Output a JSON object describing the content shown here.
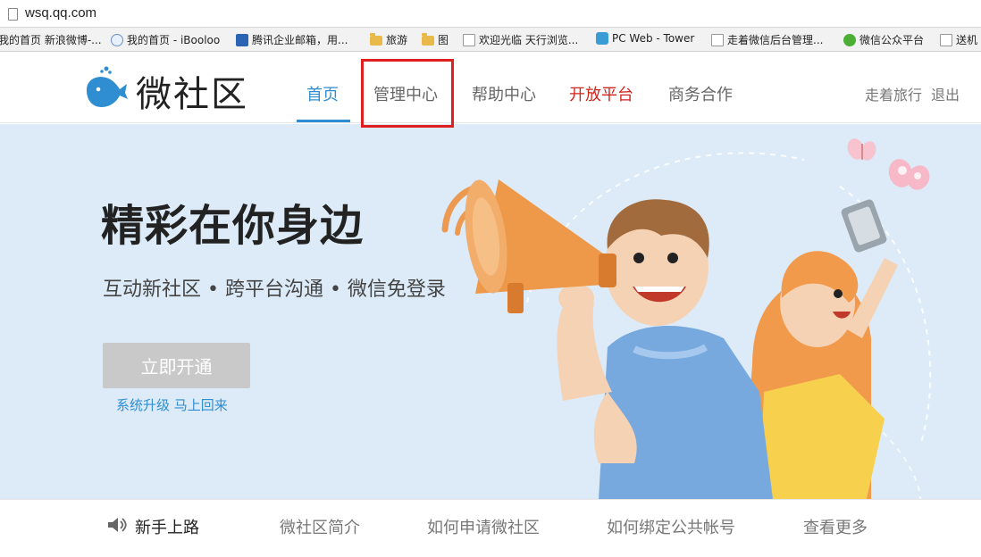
{
  "browser": {
    "url": "wsq.qq.com",
    "bookmarks": [
      {
        "label": "我的首页 新浪微博-...",
        "icon": "none"
      },
      {
        "label": "我的首页 - iBooloo",
        "icon": "globe-icon"
      },
      {
        "label": "腾讯企业邮箱，用...",
        "icon": "tencent-icon"
      },
      {
        "label": "旅游",
        "icon": "folder-icon"
      },
      {
        "label": "图",
        "icon": "folder-icon"
      },
      {
        "label": "欢迎光临 天行浏览...",
        "icon": "page-icon"
      },
      {
        "label": "PC Web - Tower",
        "icon": "tower-icon"
      },
      {
        "label": "走着微信后台管理...",
        "icon": "page-icon"
      },
      {
        "label": "微信公众平台",
        "icon": "wechat-icon"
      },
      {
        "label": "送机",
        "icon": "page-icon"
      }
    ]
  },
  "header": {
    "logo_text": "微社区",
    "nav": [
      "首页",
      "管理中心",
      "帮助中心",
      "开放平台",
      "商务合作"
    ],
    "user": "走着旅行",
    "logout": "退出"
  },
  "hero": {
    "title": "精彩在你身边",
    "subtitle": "互动新社区 • 跨平台沟通 • 微信免登录",
    "cta": "立即开通",
    "note": "系统升级 马上回来"
  },
  "bottom_nav": [
    "新手上路",
    "微社区简介",
    "如何申请微社区",
    "如何绑定公共帐号",
    "查看更多"
  ],
  "colors": {
    "accent": "#2f8ed1",
    "red": "#d0261e",
    "hero_bg": "#dcebf7",
    "highlight": "#e02020"
  }
}
